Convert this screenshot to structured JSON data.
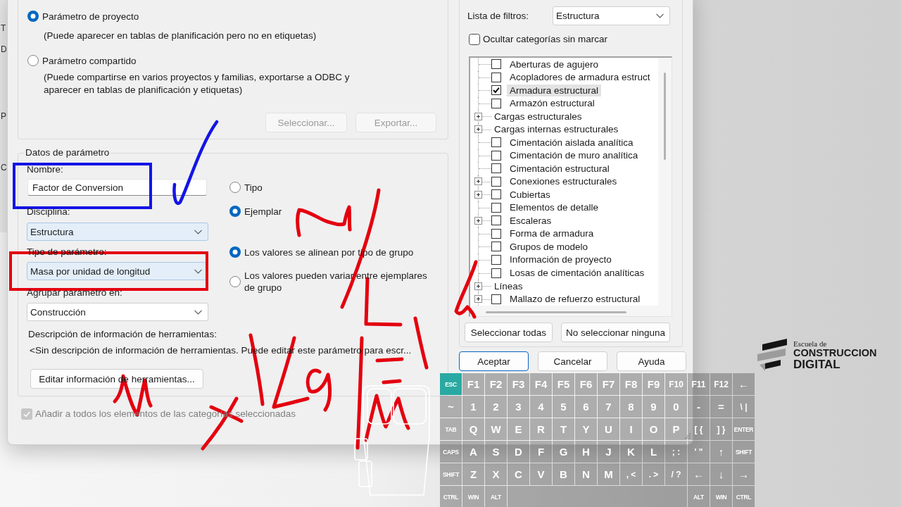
{
  "background_window": {
    "labels": [
      "T",
      "D",
      "P",
      "C"
    ]
  },
  "dialog": {
    "parameter_kind": {
      "options": [
        {
          "label": "Parámetro de proyecto",
          "description": "(Puede aparecer en tablas de planificación pero no en etiquetas)",
          "selected": true
        },
        {
          "label": "Parámetro compartido",
          "description": "(Puede compartirse en varios proyectos y familias, exportarse a ODBC y aparecer en tablas de planificación y etiquetas)",
          "selected": false
        }
      ],
      "buttons": [
        {
          "label": "Seleccionar...",
          "disabled": true
        },
        {
          "label": "Exportar...",
          "disabled": true
        }
      ]
    },
    "parameter_data": {
      "title": "Datos de parámetro",
      "fields": [
        {
          "label": "Nombre:",
          "value": "Factor de Conversion",
          "kind": "text",
          "highlighted": false
        },
        {
          "label": "Disciplina:",
          "value": "Estructura",
          "kind": "dropdown",
          "highlighted": true
        },
        {
          "label": "Tipo de parámetro:",
          "value": "Masa por unidad de longitud",
          "kind": "dropdown",
          "highlighted": true
        },
        {
          "label": "Agrupar parámetro en:",
          "value": "Construcción",
          "kind": "dropdown",
          "highlighted": false
        }
      ],
      "scope_options": [
        {
          "label": "Tipo",
          "selected": false
        },
        {
          "label": "Ejemplar",
          "selected": true
        }
      ],
      "group_value_options": [
        {
          "label": "Los valores se alinean por tipo de grupo",
          "selected": true
        },
        {
          "label": "Los valores pueden variar entre ejemplares de grupo",
          "selected": false
        }
      ],
      "tooltip_label": "Descripción de información de herramientas:",
      "tooltip_text": "<Sin descripción de información de herramientas. Puede editar este parámetro para escr...",
      "tooltip_button": "Editar información de herramientas..."
    },
    "add_to_all": {
      "label": "Añadir a todos los elementos de las categorías seleccionadas",
      "checked": true,
      "disabled": true
    },
    "categories": {
      "filter_label": "Lista de filtros:",
      "filter_value": "Estructura",
      "hide_unchecked": {
        "label": "Ocultar categorías sin marcar",
        "checked": false
      },
      "items": [
        {
          "label": "Aberturas de agujero",
          "kind": "checkbox",
          "expandable": false,
          "checked": false,
          "selected": false
        },
        {
          "label": "Acopladores de armadura estruct",
          "kind": "checkbox",
          "expandable": false,
          "checked": false,
          "selected": false
        },
        {
          "label": "Armadura estructural",
          "kind": "checkbox",
          "expandable": false,
          "checked": true,
          "selected": true
        },
        {
          "label": "Armazón estructural",
          "kind": "checkbox",
          "expandable": false,
          "checked": false,
          "selected": false
        },
        {
          "label": "Cargas estructurales",
          "kind": "heading",
          "expandable": true,
          "selected": false
        },
        {
          "label": "Cargas internas estructurales",
          "kind": "heading",
          "expandable": true,
          "selected": false
        },
        {
          "label": "Cimentación aislada analítica",
          "kind": "checkbox",
          "expandable": false,
          "checked": false,
          "selected": false
        },
        {
          "label": "Cimentación de muro analítica",
          "kind": "checkbox",
          "expandable": false,
          "checked": false,
          "selected": false
        },
        {
          "label": "Cimentación estructural",
          "kind": "checkbox",
          "expandable": false,
          "checked": false,
          "selected": false
        },
        {
          "label": "Conexiones estructurales",
          "kind": "checkbox",
          "expandable": true,
          "checked": false,
          "selected": false
        },
        {
          "label": "Cubiertas",
          "kind": "checkbox",
          "expandable": true,
          "checked": false,
          "selected": false
        },
        {
          "label": "Elementos de detalle",
          "kind": "checkbox",
          "expandable": false,
          "checked": false,
          "selected": false
        },
        {
          "label": "Escaleras",
          "kind": "checkbox",
          "expandable": true,
          "checked": false,
          "selected": false
        },
        {
          "label": "Forma de armadura",
          "kind": "checkbox",
          "expandable": false,
          "checked": false,
          "selected": false
        },
        {
          "label": "Grupos de modelo",
          "kind": "checkbox",
          "expandable": false,
          "checked": false,
          "selected": false
        },
        {
          "label": "Información de proyecto",
          "kind": "checkbox",
          "expandable": false,
          "checked": false,
          "selected": false
        },
        {
          "label": "Losas de cimentación analíticas",
          "kind": "checkbox",
          "expandable": false,
          "checked": false,
          "selected": false
        },
        {
          "label": "Líneas",
          "kind": "heading",
          "expandable": true,
          "selected": false
        },
        {
          "label": "Mallazo de refuerzo estructural",
          "kind": "checkbox",
          "expandable": true,
          "checked": false,
          "selected": false
        }
      ],
      "buttons": [
        "Seleccionar todas",
        "No seleccionar ninguna"
      ]
    },
    "footer_buttons": [
      {
        "label": "Aceptar",
        "default": true
      },
      {
        "label": "Cancelar",
        "default": false
      },
      {
        "label": "Ayuda",
        "default": false
      }
    ]
  },
  "keyboard": {
    "rows": [
      [
        {
          "label": "ESC",
          "kind": "modifier",
          "highlighted": true
        },
        {
          "label": "F1",
          "kind": "char",
          "highlighted": false
        },
        {
          "label": "F2",
          "kind": "char",
          "highlighted": false
        },
        {
          "label": "F3",
          "kind": "char",
          "highlighted": false
        },
        {
          "label": "F4",
          "kind": "char",
          "highlighted": false
        },
        {
          "label": "F5",
          "kind": "char",
          "highlighted": false
        },
        {
          "label": "F6",
          "kind": "char",
          "highlighted": false
        },
        {
          "label": "F7",
          "kind": "char",
          "highlighted": false
        },
        {
          "label": "F8",
          "kind": "char",
          "highlighted": false
        },
        {
          "label": "F9",
          "kind": "char",
          "highlighted": false
        },
        {
          "label": "F10",
          "kind": "char",
          "highlighted": false
        },
        {
          "label": "F11",
          "kind": "char",
          "highlighted": false
        },
        {
          "label": "F12",
          "kind": "char",
          "highlighted": false
        },
        {
          "label": "←",
          "kind": "char",
          "highlighted": false
        }
      ],
      [
        {
          "label": "~",
          "kind": "char",
          "highlighted": false
        },
        {
          "label": "1",
          "kind": "char",
          "highlighted": false
        },
        {
          "label": "2",
          "kind": "char",
          "highlighted": false
        },
        {
          "label": "3",
          "kind": "char",
          "highlighted": false
        },
        {
          "label": "4",
          "kind": "char",
          "highlighted": false
        },
        {
          "label": "5",
          "kind": "char",
          "highlighted": false
        },
        {
          "label": "6",
          "kind": "char",
          "highlighted": false
        },
        {
          "label": "7",
          "kind": "char",
          "highlighted": false
        },
        {
          "label": "8",
          "kind": "char",
          "highlighted": false
        },
        {
          "label": "9",
          "kind": "char",
          "highlighted": false
        },
        {
          "label": "0",
          "kind": "char",
          "highlighted": false
        },
        {
          "label": "-",
          "kind": "char",
          "highlighted": false
        },
        {
          "label": "=",
          "kind": "char",
          "highlighted": false
        },
        {
          "label": "\\ |",
          "kind": "char",
          "highlighted": false
        }
      ],
      [
        {
          "label": "TAB",
          "kind": "modifier",
          "highlighted": false
        },
        {
          "label": "Q",
          "kind": "char",
          "highlighted": false
        },
        {
          "label": "W",
          "kind": "char",
          "highlighted": false
        },
        {
          "label": "E",
          "kind": "char",
          "highlighted": false
        },
        {
          "label": "R",
          "kind": "char",
          "highlighted": false
        },
        {
          "label": "T",
          "kind": "char",
          "highlighted": false
        },
        {
          "label": "Y",
          "kind": "char",
          "highlighted": false
        },
        {
          "label": "U",
          "kind": "char",
          "highlighted": false
        },
        {
          "label": "I",
          "kind": "char",
          "highlighted": false
        },
        {
          "label": "O",
          "kind": "char",
          "highlighted": false
        },
        {
          "label": "P",
          "kind": "char",
          "highlighted": false
        },
        {
          "label": "[ {",
          "kind": "char",
          "highlighted": false
        },
        {
          "label": "] }",
          "kind": "char",
          "highlighted": false
        },
        {
          "label": "ENTER",
          "kind": "modifier",
          "highlighted": false
        }
      ],
      [
        {
          "label": "CAPS",
          "kind": "modifier",
          "highlighted": false
        },
        {
          "label": "A",
          "kind": "char",
          "highlighted": false
        },
        {
          "label": "S",
          "kind": "char",
          "highlighted": false
        },
        {
          "label": "D",
          "kind": "char",
          "highlighted": false
        },
        {
          "label": "F",
          "kind": "char",
          "highlighted": false
        },
        {
          "label": "G",
          "kind": "char",
          "highlighted": false
        },
        {
          "label": "H",
          "kind": "char",
          "highlighted": false
        },
        {
          "label": "J",
          "kind": "char",
          "highlighted": false
        },
        {
          "label": "K",
          "kind": "char",
          "highlighted": false
        },
        {
          "label": "L",
          "kind": "char",
          "highlighted": false
        },
        {
          "label": "; :",
          "kind": "char",
          "highlighted": false
        },
        {
          "label": "' \"",
          "kind": "char",
          "highlighted": false
        },
        {
          "label": "↑",
          "kind": "char",
          "highlighted": false
        },
        {
          "label": "SHIFT",
          "kind": "modifier",
          "highlighted": false
        }
      ],
      [
        {
          "label": "SHIFT",
          "kind": "modifier",
          "highlighted": false
        },
        {
          "label": "Z",
          "kind": "char",
          "highlighted": false
        },
        {
          "label": "X",
          "kind": "char",
          "highlighted": false
        },
        {
          "label": "C",
          "kind": "char",
          "highlighted": false
        },
        {
          "label": "V",
          "kind": "char",
          "highlighted": false
        },
        {
          "label": "B",
          "kind": "char",
          "highlighted": false
        },
        {
          "label": "N",
          "kind": "char",
          "highlighted": false
        },
        {
          "label": "M",
          "kind": "char",
          "highlighted": false
        },
        {
          "label": ", <",
          "kind": "char",
          "highlighted": false
        },
        {
          "label": ". >",
          "kind": "char",
          "highlighted": false
        },
        {
          "label": "/ ?",
          "kind": "char",
          "highlighted": false
        },
        {
          "label": "←",
          "kind": "char",
          "highlighted": false
        },
        {
          "label": "↓",
          "kind": "char",
          "highlighted": false
        },
        {
          "label": "→",
          "kind": "char",
          "highlighted": false
        }
      ]
    ],
    "bottom_row": {
      "left_keys": [
        {
          "label": "CTRL",
          "kind": "modifier",
          "highlighted": false
        },
        {
          "label": "WIN",
          "kind": "modifier",
          "highlighted": false
        },
        {
          "label": "ALT",
          "kind": "modifier",
          "highlighted": false
        }
      ],
      "right_keys": [
        {
          "label": "ALT",
          "kind": "modifier",
          "highlighted": false
        },
        {
          "label": "WIN",
          "kind": "modifier",
          "highlighted": false
        },
        {
          "label": "CTRL",
          "kind": "modifier",
          "highlighted": false
        }
      ]
    }
  },
  "logo": {
    "lines": [
      "Escuela de",
      "CONSTRUCCION",
      "DIGITAL"
    ]
  }
}
